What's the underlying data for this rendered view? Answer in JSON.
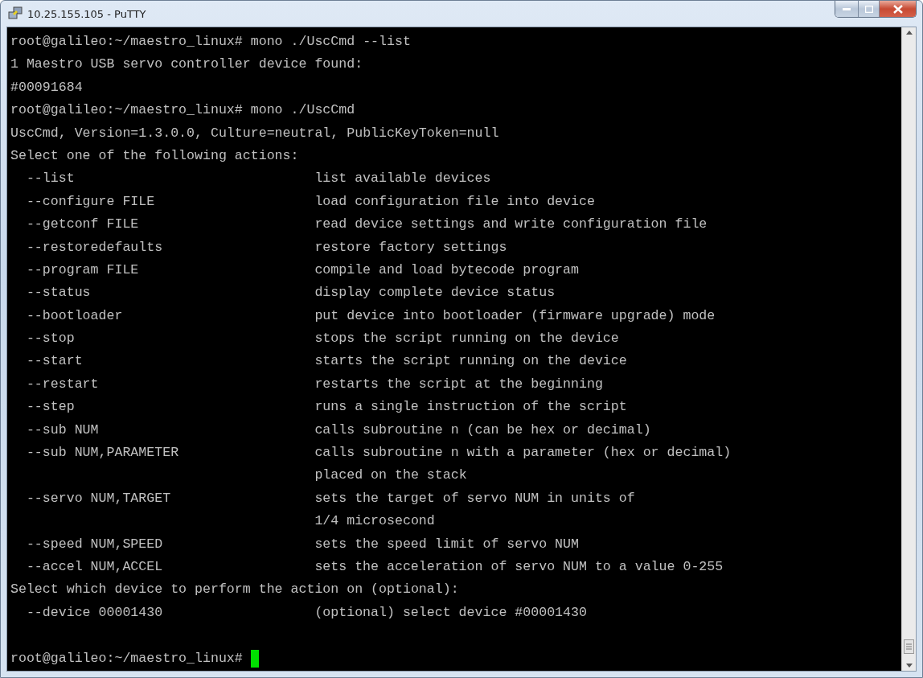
{
  "window": {
    "title": "10.25.155.105 - PuTTY"
  },
  "terminal": {
    "lines": [
      {
        "kind": "text",
        "text": "root@galileo:~/maestro_linux# mono ./UscCmd --list"
      },
      {
        "kind": "text",
        "text": "1 Maestro USB servo controller device found:"
      },
      {
        "kind": "text",
        "text": "#00091684"
      },
      {
        "kind": "text",
        "text": "root@galileo:~/maestro_linux# mono ./UscCmd"
      },
      {
        "kind": "text",
        "text": "UscCmd, Version=1.3.0.0, Culture=neutral, PublicKeyToken=null"
      },
      {
        "kind": "text",
        "text": "Select one of the following actions:"
      },
      {
        "kind": "option",
        "option": "--list",
        "description": "list available devices"
      },
      {
        "kind": "option",
        "option": "--configure FILE",
        "description": "load configuration file into device"
      },
      {
        "kind": "option",
        "option": "--getconf FILE",
        "description": "read device settings and write configuration file"
      },
      {
        "kind": "option",
        "option": "--restoredefaults",
        "description": "restore factory settings"
      },
      {
        "kind": "option",
        "option": "--program FILE",
        "description": "compile and load bytecode program"
      },
      {
        "kind": "option",
        "option": "--status",
        "description": "display complete device status"
      },
      {
        "kind": "option",
        "option": "--bootloader",
        "description": "put device into bootloader (firmware upgrade) mode"
      },
      {
        "kind": "option",
        "option": "--stop",
        "description": "stops the script running on the device"
      },
      {
        "kind": "option",
        "option": "--start",
        "description": "starts the script running on the device"
      },
      {
        "kind": "option",
        "option": "--restart",
        "description": "restarts the script at the beginning"
      },
      {
        "kind": "option",
        "option": "--step",
        "description": "runs a single instruction of the script"
      },
      {
        "kind": "option",
        "option": "--sub NUM",
        "description": "calls subroutine n (can be hex or decimal)"
      },
      {
        "kind": "option",
        "option": "--sub NUM,PARAMETER",
        "description": "calls subroutine n with a parameter (hex or decimal)"
      },
      {
        "kind": "continuation",
        "description": "placed on the stack"
      },
      {
        "kind": "option",
        "option": "--servo NUM,TARGET",
        "description": "sets the target of servo NUM in units of"
      },
      {
        "kind": "continuation",
        "description": "1/4 microsecond"
      },
      {
        "kind": "option",
        "option": "--speed NUM,SPEED",
        "description": "sets the speed limit of servo NUM"
      },
      {
        "kind": "option",
        "option": "--accel NUM,ACCEL",
        "description": "sets the acceleration of servo NUM to a value 0-255"
      },
      {
        "kind": "text",
        "text": "Select which device to perform the action on (optional):"
      },
      {
        "kind": "option",
        "option": "--device 00001430",
        "description": "(optional) select device #00001430"
      },
      {
        "kind": "blank"
      },
      {
        "kind": "prompt",
        "text": "root@galileo:~/maestro_linux#",
        "cursor": true
      }
    ]
  }
}
